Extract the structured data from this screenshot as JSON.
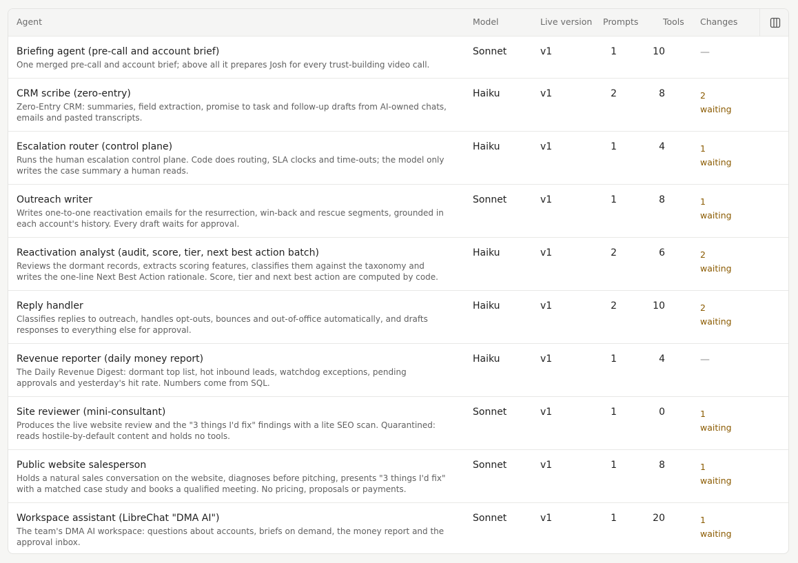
{
  "columns": {
    "agent": "Agent",
    "model": "Model",
    "live_version": "Live version",
    "prompts": "Prompts",
    "tools": "Tools",
    "changes": "Changes",
    "columns_icon": "columns-icon"
  },
  "agents": [
    {
      "name": "Briefing agent (pre-call and account brief)",
      "description": "One merged pre-call and account brief; above all it prepares Josh for every trust-building video call.",
      "model": "Sonnet",
      "version": "v1",
      "prompts": "1",
      "tools": "10",
      "changes_count": "—",
      "changes_label": ""
    },
    {
      "name": "CRM scribe (zero-entry)",
      "description": "Zero-Entry CRM: summaries, field extraction, promise to task and follow-up drafts from AI-owned chats, emails and pasted transcripts.",
      "model": "Haiku",
      "version": "v1",
      "prompts": "2",
      "tools": "8",
      "changes_count": "2",
      "changes_label": "waiting"
    },
    {
      "name": "Escalation router (control plane)",
      "description": "Runs the human escalation control plane. Code does routing, SLA clocks and time-outs; the model only writes the case summary a human reads.",
      "model": "Haiku",
      "version": "v1",
      "prompts": "1",
      "tools": "4",
      "changes_count": "1",
      "changes_label": "waiting"
    },
    {
      "name": "Outreach writer",
      "description": "Writes one-to-one reactivation emails for the resurrection, win-back and rescue segments, grounded in each account's history. Every draft waits for approval.",
      "model": "Sonnet",
      "version": "v1",
      "prompts": "1",
      "tools": "8",
      "changes_count": "1",
      "changes_label": "waiting"
    },
    {
      "name": "Reactivation analyst (audit, score, tier, next best action batch)",
      "description": "Reviews the dormant records, extracts scoring features, classifies them against the taxonomy and writes the one-line Next Best Action rationale. Score, tier and next best action are computed by code.",
      "model": "Haiku",
      "version": "v1",
      "prompts": "2",
      "tools": "6",
      "changes_count": "2",
      "changes_label": "waiting"
    },
    {
      "name": "Reply handler",
      "description": "Classifies replies to outreach, handles opt-outs, bounces and out-of-office automatically, and drafts responses to everything else for approval.",
      "model": "Haiku",
      "version": "v1",
      "prompts": "2",
      "tools": "10",
      "changes_count": "2",
      "changes_label": "waiting"
    },
    {
      "name": "Revenue reporter (daily money report)",
      "description": "The Daily Revenue Digest: dormant top list, hot inbound leads, watchdog exceptions, pending approvals and yesterday's hit rate. Numbers come from SQL.",
      "model": "Haiku",
      "version": "v1",
      "prompts": "1",
      "tools": "4",
      "changes_count": "—",
      "changes_label": ""
    },
    {
      "name": "Site reviewer (mini-consultant)",
      "description": "Produces the live website review and the \"3 things I'd fix\" findings with a lite SEO scan. Quarantined: reads hostile-by-default content and holds no tools.",
      "model": "Sonnet",
      "version": "v1",
      "prompts": "1",
      "tools": "0",
      "changes_count": "1",
      "changes_label": "waiting"
    },
    {
      "name": "Public website salesperson",
      "description": "Holds a natural sales conversation on the website, diagnoses before pitching, presents \"3 things I'd fix\" with a matched case study and books a qualified meeting. No pricing, proposals or payments.",
      "model": "Sonnet",
      "version": "v1",
      "prompts": "1",
      "tools": "8",
      "changes_count": "1",
      "changes_label": "waiting"
    },
    {
      "name": "Workspace assistant (LibreChat \"DMA AI\")",
      "description": "The team's DMA AI workspace: questions about accounts, briefs on demand, the money report and the approval inbox.",
      "model": "Sonnet",
      "version": "v1",
      "prompts": "1",
      "tools": "20",
      "changes_count": "1",
      "changes_label": "waiting"
    }
  ]
}
